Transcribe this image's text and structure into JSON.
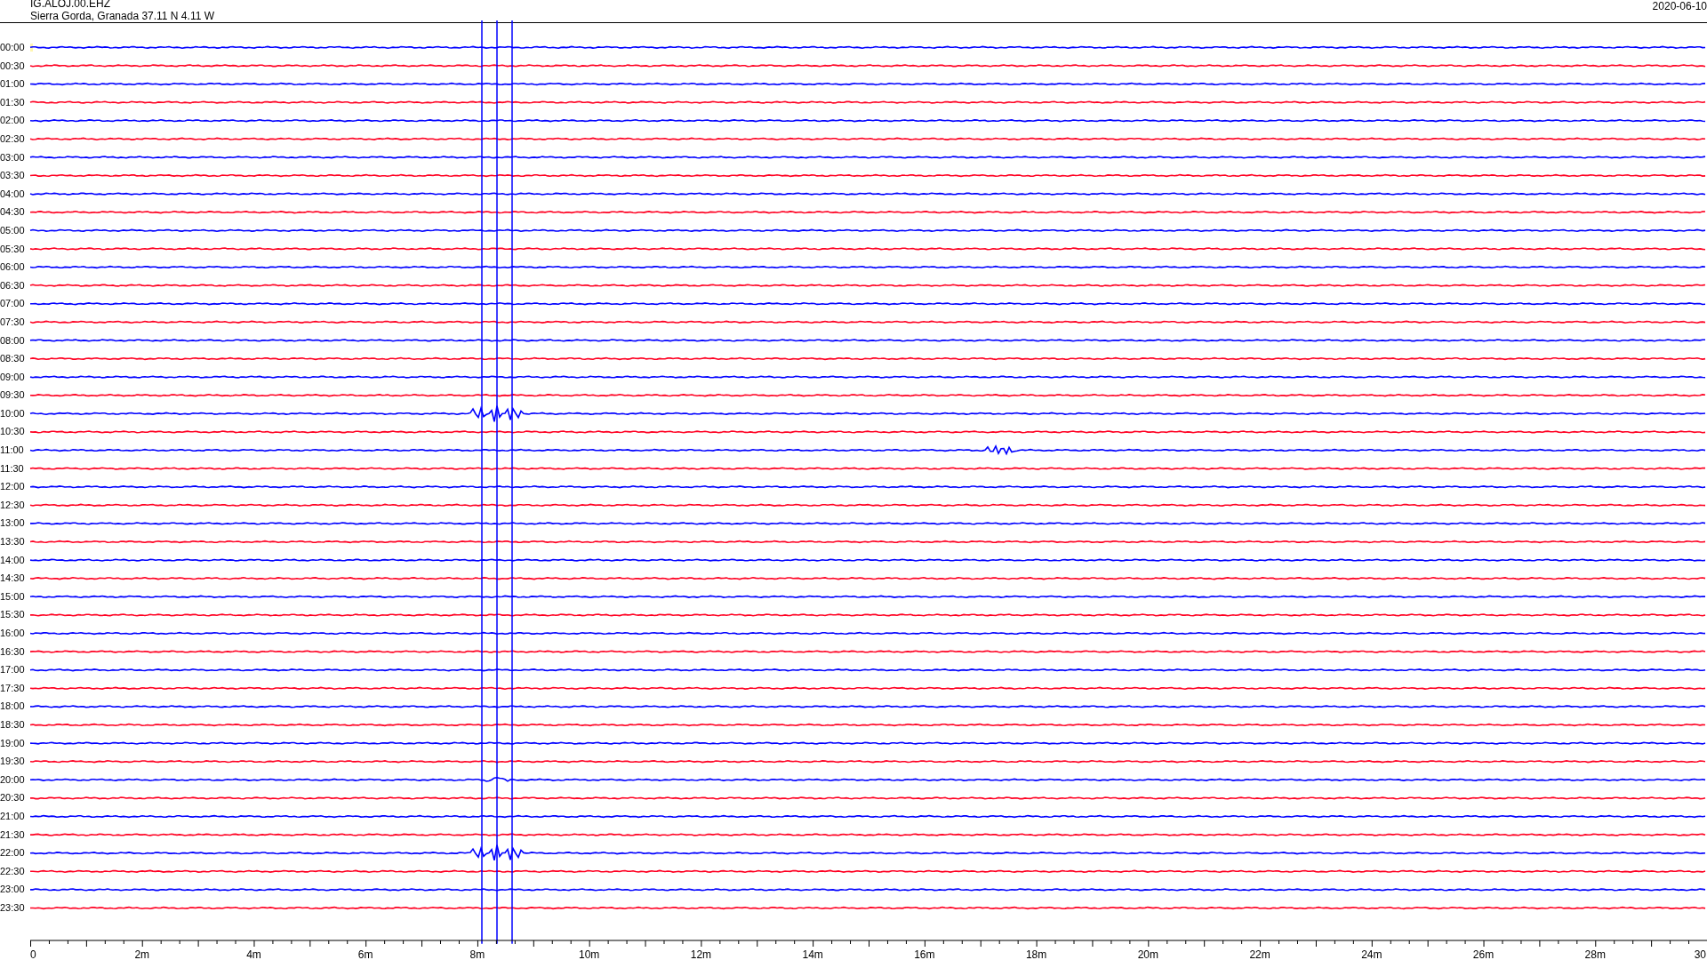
{
  "header": {
    "station": "IG.ALOJ.00.EHZ",
    "location": "Sierra Gorda, Granada  37.11 N 4.11 W",
    "date": "2020-06-10"
  },
  "rows": [
    {
      "time": "00:00",
      "color": "#0000ff"
    },
    {
      "time": "00:30",
      "color": "#ff0022"
    },
    {
      "time": "01:00",
      "color": "#0000ff"
    },
    {
      "time": "01:30",
      "color": "#ff0022"
    },
    {
      "time": "02:00",
      "color": "#0000ff"
    },
    {
      "time": "02:30",
      "color": "#ff0022"
    },
    {
      "time": "03:00",
      "color": "#0000ff"
    },
    {
      "time": "03:30",
      "color": "#ff0022"
    },
    {
      "time": "04:00",
      "color": "#0000ff"
    },
    {
      "time": "04:30",
      "color": "#ff0022"
    },
    {
      "time": "05:00",
      "color": "#0000ff"
    },
    {
      "time": "05:30",
      "color": "#ff0022"
    },
    {
      "time": "06:00",
      "color": "#0000ff"
    },
    {
      "time": "06:30",
      "color": "#ff0022"
    },
    {
      "time": "07:00",
      "color": "#0000ff"
    },
    {
      "time": "07:30",
      "color": "#ff0022"
    },
    {
      "time": "08:00",
      "color": "#0000ff"
    },
    {
      "time": "08:30",
      "color": "#ff0022"
    },
    {
      "time": "09:00",
      "color": "#0000ff"
    },
    {
      "time": "09:30",
      "color": "#ff0022"
    },
    {
      "time": "10:00",
      "color": "#0000ff"
    },
    {
      "time": "10:30",
      "color": "#ff0022"
    },
    {
      "time": "11:00",
      "color": "#0000ff"
    },
    {
      "time": "11:30",
      "color": "#ff0022"
    },
    {
      "time": "12:00",
      "color": "#0000ff"
    },
    {
      "time": "12:30",
      "color": "#ff0022"
    },
    {
      "time": "13:00",
      "color": "#0000ff"
    },
    {
      "time": "13:30",
      "color": "#ff0022"
    },
    {
      "time": "14:00",
      "color": "#0000ff"
    },
    {
      "time": "14:30",
      "color": "#ff0022"
    },
    {
      "time": "15:00",
      "color": "#0000ff"
    },
    {
      "time": "15:30",
      "color": "#ff0022"
    },
    {
      "time": "16:00",
      "color": "#0000ff"
    },
    {
      "time": "16:30",
      "color": "#ff0022"
    },
    {
      "time": "17:00",
      "color": "#0000ff"
    },
    {
      "time": "17:30",
      "color": "#ff0022"
    },
    {
      "time": "18:00",
      "color": "#0000ff"
    },
    {
      "time": "18:30",
      "color": "#ff0022"
    },
    {
      "time": "19:00",
      "color": "#0000ff"
    },
    {
      "time": "19:30",
      "color": "#ff0022"
    },
    {
      "time": "20:00",
      "color": "#0000ff"
    },
    {
      "time": "20:30",
      "color": "#ff0022"
    },
    {
      "time": "21:00",
      "color": "#0000ff"
    },
    {
      "time": "21:30",
      "color": "#ff0022"
    },
    {
      "time": "22:00",
      "color": "#0000ff"
    },
    {
      "time": "22:30",
      "color": "#ff0022"
    },
    {
      "time": "23:00",
      "color": "#0000ff"
    },
    {
      "time": "23:30",
      "color": "#ff0022"
    }
  ],
  "x_axis": {
    "labels": [
      "0",
      "2m",
      "4m",
      "6m",
      "8m",
      "10m",
      "12m",
      "14m",
      "16m",
      "18m",
      "20m",
      "22m",
      "24m",
      "26m",
      "28m",
      "30"
    ]
  }
}
